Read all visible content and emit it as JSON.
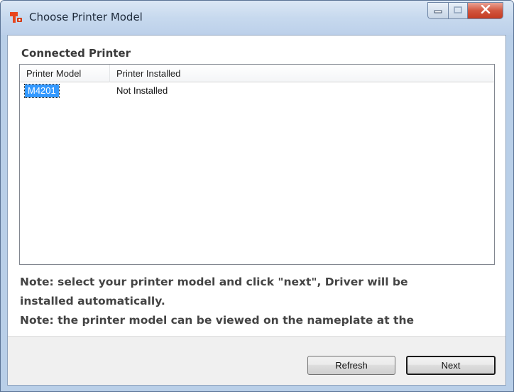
{
  "window": {
    "title": "Choose Printer Model",
    "icon": "printer-app-icon"
  },
  "caption_buttons": {
    "minimize": "minimize-icon",
    "maximize": "maximize-icon",
    "close": "close-icon"
  },
  "section": {
    "title": "Connected Printer"
  },
  "list": {
    "columns": [
      "Printer Model",
      "Printer Installed"
    ],
    "rows": [
      {
        "model": "M4201",
        "installed": "Not Installed",
        "selected": true
      }
    ]
  },
  "notes": {
    "line1": "Note: select your printer model and click \"next\", Driver will be",
    "line1b": "installed automatically.",
    "line2": "Note: the printer model can be viewed on the nameplate at the"
  },
  "buttons": {
    "refresh": "Refresh",
    "next": "Next"
  },
  "colors": {
    "selection": "#3399ff",
    "close_button": "#c9432b",
    "title_bar": "#c7d9ee"
  }
}
